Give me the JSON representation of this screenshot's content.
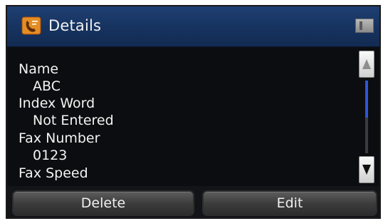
{
  "header": {
    "title": "Details",
    "left_icon": "contact-card-icon",
    "right_icon": "memory-card-icon"
  },
  "details": {
    "name_label": "Name",
    "name_value": "ABC",
    "index_word_label": "Index Word",
    "index_word_value": "Not Entered",
    "fax_number_label": "Fax Number",
    "fax_number_value": "0123",
    "fax_speed_label": "Fax Speed"
  },
  "scrollbar": {
    "up_icon": "scroll-up-icon",
    "down_icon": "scroll-down-icon",
    "accent_color": "#2e56d8"
  },
  "actions": {
    "delete_label": "Delete",
    "edit_label": "Edit"
  },
  "colors": {
    "title_bar": "#16325e",
    "background": "#0b0d10",
    "text": "#f3f3f3",
    "button": "#3d3d3d"
  }
}
